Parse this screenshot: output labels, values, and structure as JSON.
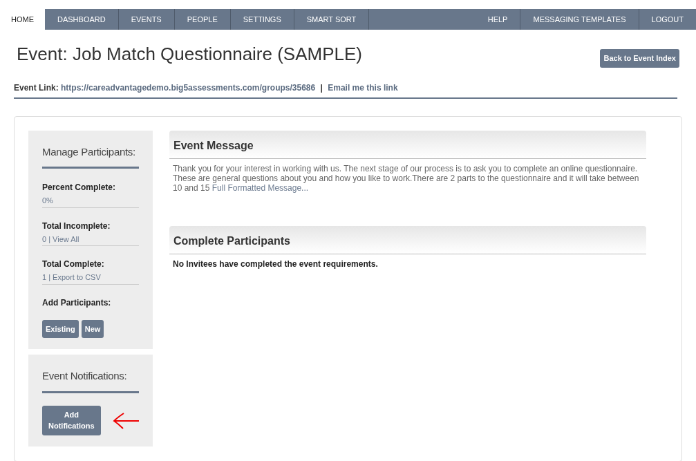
{
  "nav": {
    "left": [
      {
        "label": "HOME",
        "selected": true
      },
      {
        "label": "DASHBOARD",
        "selected": false
      },
      {
        "label": "EVENTS",
        "selected": false
      },
      {
        "label": "PEOPLE",
        "selected": false
      },
      {
        "label": "SETTINGS",
        "selected": false
      },
      {
        "label": "SMART SORT",
        "selected": false
      }
    ],
    "right": [
      {
        "label": "HELP",
        "selected": false
      },
      {
        "label": "MESSAGING TEMPLATES",
        "selected": false
      },
      {
        "label": "LOGOUT",
        "selected": false
      }
    ]
  },
  "title": "Event: Job Match Questionnaire (SAMPLE)",
  "back_button": "Back to Event Index",
  "event_link": {
    "label": "Event Link:",
    "url": "https://careadvantagedemo.big5assessments.com/groups/35686",
    "separator": "|",
    "email_link": "Email me this link"
  },
  "manage": {
    "title": "Manage Participants:",
    "stats": [
      {
        "label": "Percent Complete:",
        "value": "0%"
      },
      {
        "label": "Total Incomplete:",
        "value": "0 | View All"
      },
      {
        "label": "Total Complete:",
        "value": "1 | Export to CSV"
      }
    ],
    "add_label": "Add Participants:",
    "buttons": [
      "Existing",
      "New"
    ]
  },
  "notifications": {
    "title": "Event Notifications:",
    "button": "Add Notifications"
  },
  "event_message": {
    "title": "Event Message",
    "text": "Thank you for your interest in working with us. The next stage of our process is to ask you to complete an online questionnaire. These are general questions about you and how you like to work.There are 2 parts to the questionnaire and it will take between 10 and 15",
    "link": "Full Formatted Message..."
  },
  "complete_participants": {
    "title": "Complete Participants",
    "empty_text": "No Invitees have completed the event requirements."
  }
}
